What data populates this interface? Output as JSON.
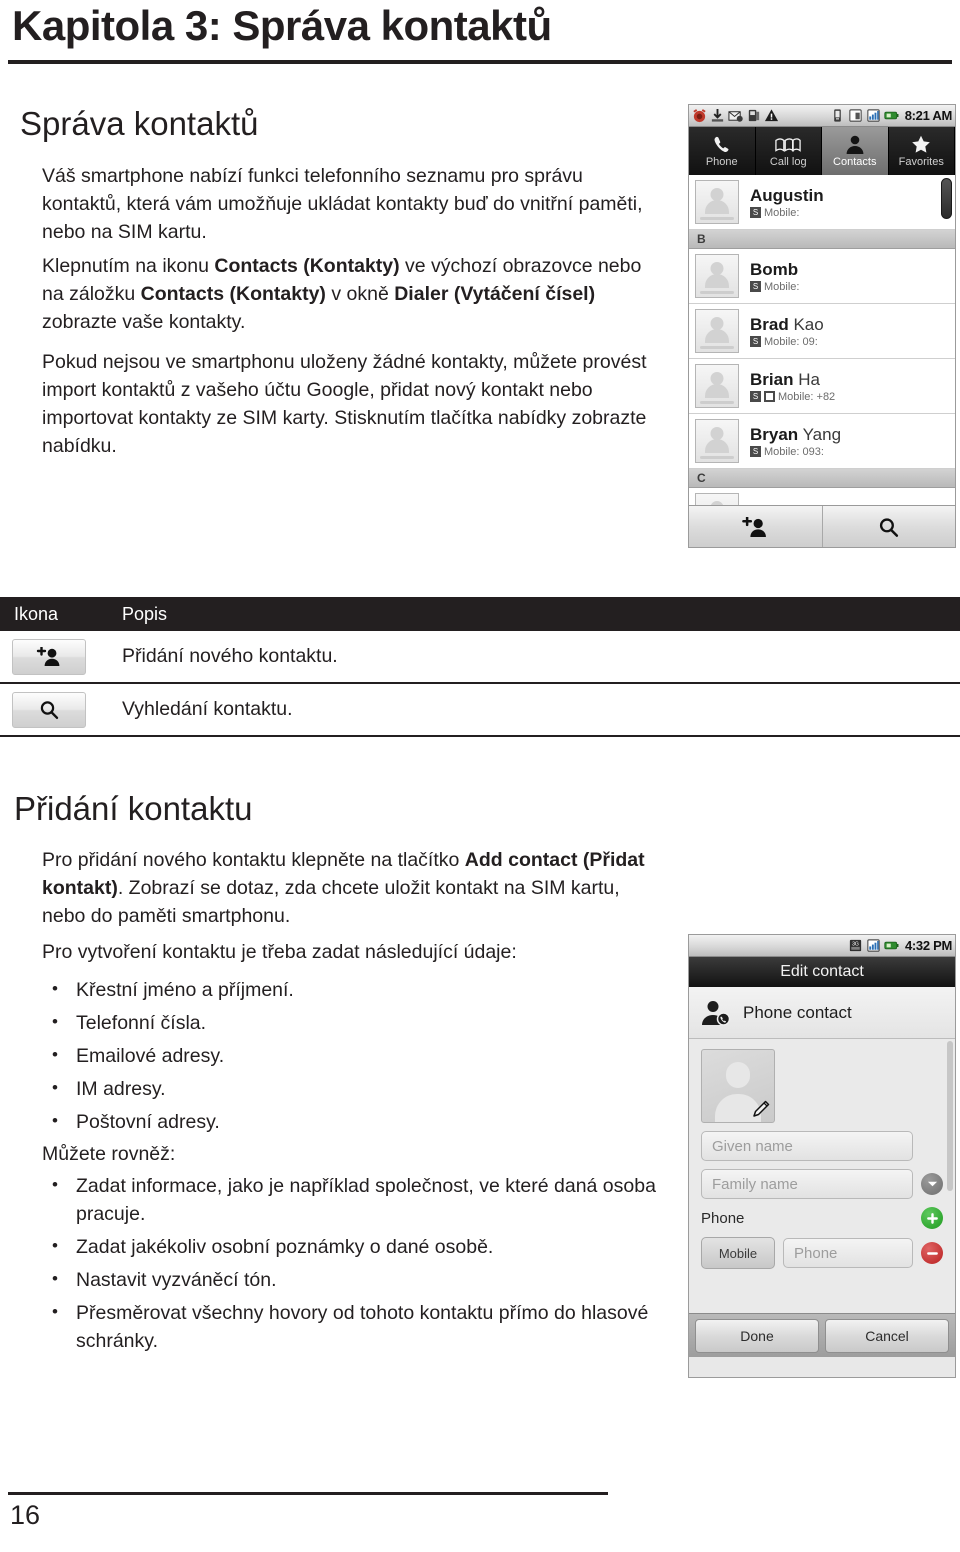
{
  "document": {
    "chapter_title": "Kapitola 3: Správa kontaktů",
    "page_number": "16"
  },
  "sections": {
    "sprava_kontaktu": {
      "heading": "Správa kontaktů",
      "paragraph_1": "Váš smartphone nabízí funkci telefonního seznamu pro správu kontaktů, která vám umožňuje ukládat kontakty buď do vnitřní paměti, nebo na SIM kartu.",
      "paragraph_2_parts": {
        "a": "Klepnutím na ikonu ",
        "b1": "Contacts (Kontakty)",
        "c": " ve výchozí obrazovce nebo na záložku ",
        "b2": "Contacts (Kontakty)",
        "d": " v okně ",
        "b3": "Dialer (Vytáčení čísel)",
        "e": " zobrazte vaše kontakty."
      },
      "paragraph_3": "Pokud nejsou ve smartphonu uloženy žádné kontakty, můžete provést import kontaktů z vašeho účtu Google, přidat nový kontakt nebo importovat kontakty ze SIM karty. Stisknutím tlačítka nabídky zobrazte nabídku."
    },
    "pridani_kontaktu": {
      "heading": "Přidání kontaktu",
      "paragraph_1_parts": {
        "a": "Pro přidání nového kontaktu klepněte na tlačítko ",
        "b": "Add contact (Přidat kontakt)",
        "c": ". Zobrazí se dotaz, zda chcete uložit kontakt na SIM kartu, nebo do paměti smartphonu."
      },
      "paragraph_2": "Pro vytvoření kontaktu je třeba zadat následující údaje:",
      "list_1": [
        "Křestní jméno a příjmení.",
        "Telefonní čísla.",
        "Emailové adresy.",
        "IM adresy.",
        "Poštovní adresy."
      ],
      "paragraph_3": "Můžete rovněž:",
      "list_2": [
        "Zadat informace, jako je například společnost, ve které daná osoba pracuje.",
        "Zadat jakékoliv osobní poznámky o dané osobě.",
        "Nastavit vyzváněcí tón.",
        "Přesměrovat všechny hovory od tohoto kontaktu přímo do hlasové schránky."
      ]
    }
  },
  "icon_table": {
    "headers": {
      "icon": "Ikona",
      "description": "Popis"
    },
    "rows": [
      {
        "icon_name": "add-contact-icon",
        "description": "Přidání nového kontaktu."
      },
      {
        "icon_name": "search-icon",
        "description": "Vyhledání kontaktu."
      }
    ]
  },
  "phone_contacts": {
    "statusbar": {
      "time": "8:21 AM",
      "left_icons": [
        "alarm-icon",
        "download-icon",
        "mail-sync-icon",
        "sd-card-icon",
        "warning-icon"
      ],
      "right_icons": [
        "vibrate-icon",
        "sim-icon",
        "signal-icon",
        "battery-icon"
      ]
    },
    "tabs": [
      {
        "label": "Phone",
        "icon": "handset-icon",
        "active": false
      },
      {
        "label": "Call log",
        "icon": "book-icon",
        "active": false
      },
      {
        "label": "Contacts",
        "icon": "person-icon",
        "active": true
      },
      {
        "label": "Favorites",
        "icon": "star-icon",
        "active": false
      }
    ],
    "contacts": [
      {
        "first": "Augustin",
        "last": "",
        "sub": "Mobile:",
        "badges": [
          "sim"
        ]
      },
      {
        "divider": "B"
      },
      {
        "first": "Bomb",
        "last": "",
        "sub": "Mobile:",
        "badges": [
          "sim"
        ]
      },
      {
        "first": "Brad",
        "last": "Kao",
        "sub": "Mobile: 09:",
        "badges": [
          "sim"
        ]
      },
      {
        "first": "Brian",
        "last": "Ha",
        "sub": "Mobile: +82",
        "badges": [
          "sim",
          "square"
        ]
      },
      {
        "first": "Bryan",
        "last": "Yang",
        "sub": "Mobile: 093:",
        "badges": [
          "sim"
        ]
      },
      {
        "divider": "C"
      }
    ],
    "bottom_buttons": [
      {
        "icon": "add-contact-icon"
      },
      {
        "icon": "search-icon"
      }
    ]
  },
  "phone_edit": {
    "statusbar": {
      "time": "4:32 PM",
      "right_icons": [
        "3g-icon",
        "signal-icon",
        "battery-icon"
      ]
    },
    "title": "Edit contact",
    "account_row": {
      "label": "Phone contact",
      "icon": "phone-contact-icon"
    },
    "photo": {
      "icon": "photo-placeholder-icon",
      "edit_icon": "pencil-icon"
    },
    "fields": [
      {
        "placeholder": "Given name",
        "trailing": null
      },
      {
        "placeholder": "Family name",
        "trailing": "chevron-down-icon"
      }
    ],
    "phone_section": {
      "label": "Phone",
      "add_icon": "plus-icon",
      "type_label": "Mobile",
      "placeholder": "Phone",
      "remove_icon": "minus-icon"
    },
    "footer_buttons": [
      {
        "label": "Done"
      },
      {
        "label": "Cancel"
      }
    ]
  },
  "colors": {
    "ink": "#231f20",
    "rule": "#231f20",
    "table_header_bg": "#231f20",
    "accent_green": "#2a9a2a",
    "accent_red": "#b81f1f"
  }
}
